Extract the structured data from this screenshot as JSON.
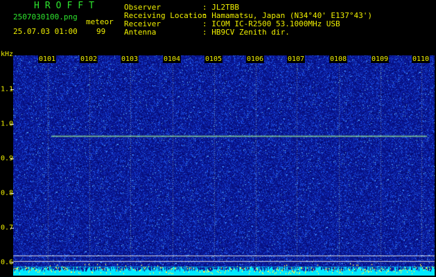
{
  "header": {
    "brand": "HROFFT",
    "filename": "2507030100.png",
    "datetime": "25.07.03 01:00",
    "mode_label": "meteor",
    "count": "99",
    "fields": [
      {
        "label": "Observer",
        "value": ": JL2TBB"
      },
      {
        "label": "Receiving Location",
        "value": ": Hamamatsu, Japan (N34°40' E137°43')"
      },
      {
        "label": "Receiver",
        "value": ": ICOM IC-R2500 53.1000MHz USB"
      },
      {
        "label": "Antenna",
        "value": ": HB9CV Zenith dir."
      }
    ]
  },
  "spectrogram": {
    "y_unit": "kHz",
    "y_ticks": [
      "1.1",
      "1.0",
      "0.9",
      "0.8",
      "0.7",
      "0.6"
    ],
    "y_values": [
      1.1,
      1.0,
      0.9,
      0.8,
      0.7,
      0.6
    ],
    "time_labels": [
      "0101",
      "0102",
      "0103",
      "0104",
      "0105",
      "0106",
      "0107",
      "0108",
      "0109",
      "0110"
    ],
    "trace_freq_khz": 0.965,
    "colors": {
      "background": "#0a1a9a",
      "trace": "#a8ff90",
      "label": "#f0f000",
      "header": "#2ee62e"
    }
  }
}
